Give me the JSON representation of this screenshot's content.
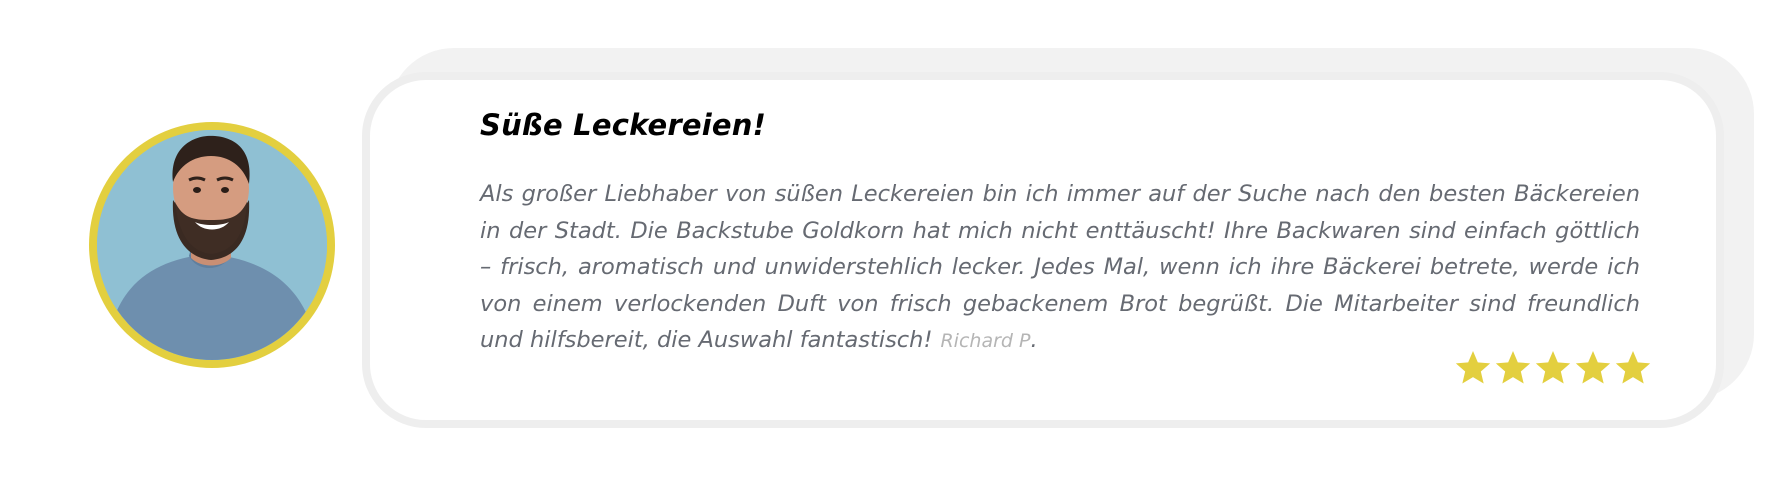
{
  "testimonial": {
    "title": "Süße Leckereien!",
    "text": "Als großer Liebhaber von süßen Leckereien bin ich immer auf der Suche nach den besten Bäckereien in der Stadt. Die Backstube Goldkorn hat mich nicht enttäuscht! Ihre Backwaren sind einfach göttlich – frisch, aromatisch und unwiderstehlich lecker. Jedes Mal, wenn ich ihre Bäckerei betrete, werde ich von einem verlockenden Duft von frisch gebackenem Brot begrüßt. Die Mitarbeiter sind freundlich und hilfsbereit, die Auswahl fantastisch!",
    "author": "Richard P",
    "author_suffix": ".",
    "rating": 5,
    "rating_max": 5
  },
  "icons": {
    "star": "star-icon"
  },
  "colors": {
    "accent": "#e3cf3f",
    "card_border": "#eeeeee",
    "text": "#666a72",
    "author": "#b5b5b5"
  }
}
